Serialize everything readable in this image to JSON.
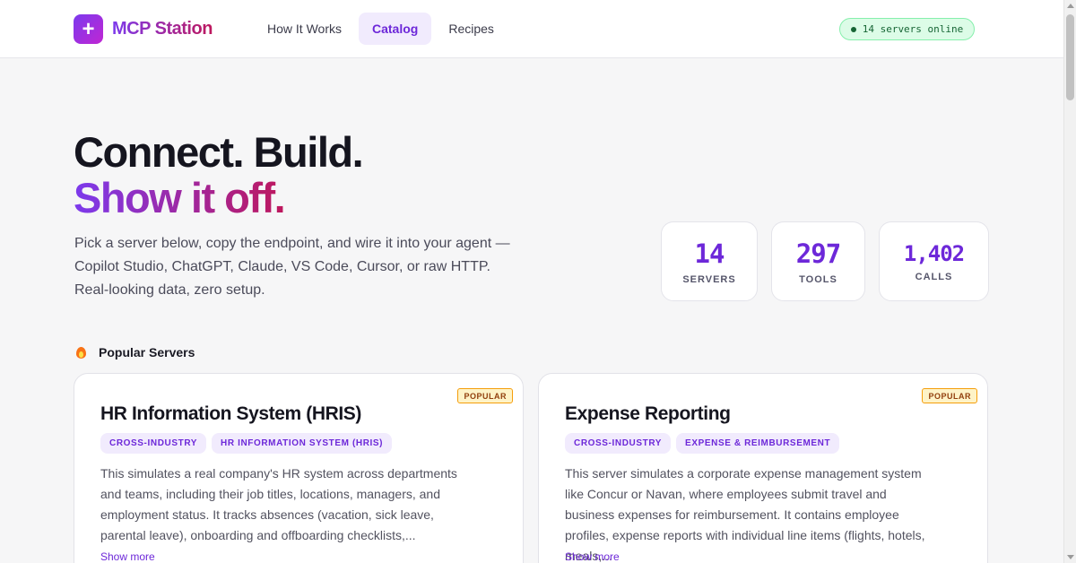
{
  "header": {
    "logo_glyph": "+",
    "brand": "MCP Station",
    "nav": [
      {
        "label": "How It Works",
        "active": false
      },
      {
        "label": "Catalog",
        "active": true
      },
      {
        "label": "Recipes",
        "active": false
      }
    ],
    "status": "14 servers online"
  },
  "hero": {
    "title_line1": "Connect. Build.",
    "title_line2": "Show it off.",
    "description": "Pick a server below, copy the endpoint, and wire it into your agent — Copilot Studio, ChatGPT, Claude, VS Code, Cursor, or raw HTTP. Real-looking data, zero setup."
  },
  "stats": [
    {
      "value": "14",
      "label": "SERVERS"
    },
    {
      "value": "297",
      "label": "TOOLS"
    },
    {
      "value": "1,402",
      "label": "CALLS"
    }
  ],
  "popular": {
    "heading": "Popular Servers",
    "icon": "flame-icon",
    "cards": [
      {
        "badge": "POPULAR",
        "title": "HR Information System (HRIS)",
        "tags": [
          "CROSS-INDUSTRY",
          "HR INFORMATION SYSTEM (HRIS)"
        ],
        "description": "This simulates a real company's HR system across departments and teams, including their job titles, locations, managers, and employment status. It tracks absences (vacation, sick leave, parental leave), onboarding and offboarding checklists,...",
        "show_more": "Show more"
      },
      {
        "badge": "POPULAR",
        "title": "Expense Reporting",
        "tags": [
          "CROSS-INDUSTRY",
          "EXPENSE & REIMBURSEMENT"
        ],
        "description": "This server simulates a corporate expense management system like Concur or Navan, where employees submit travel and business expenses for reimbursement. It contains employee profiles, expense reports with individual line items (flights, hotels, meals,...",
        "show_more": "Show more"
      }
    ]
  },
  "colors": {
    "accent": "#6d28d9",
    "brand_gradient_start": "#7c3aed",
    "brand_gradient_end": "#be185d",
    "status_bg": "#dcfce7",
    "popular_badge_bg": "#fef3c7"
  }
}
